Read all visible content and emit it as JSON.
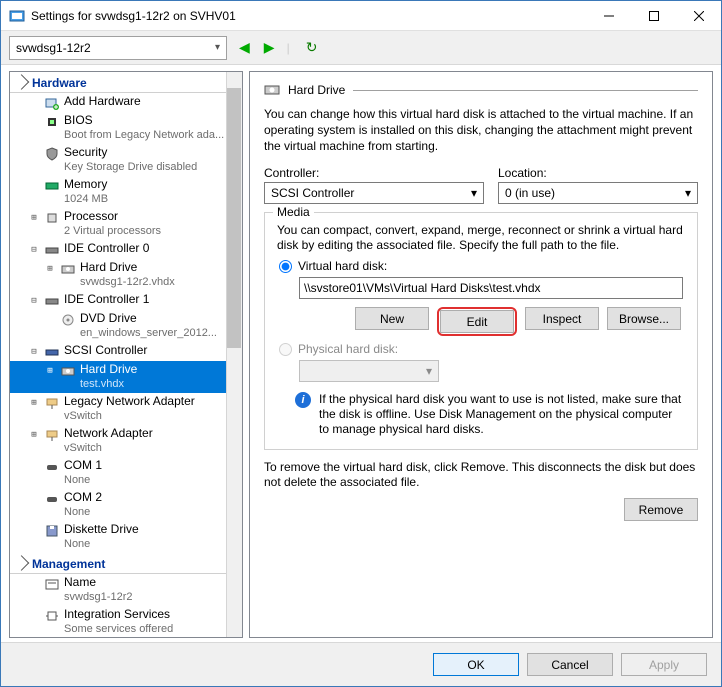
{
  "title": "Settings for svwdsg1-12r2 on SVHV01",
  "toolbar": {
    "vm_selected": "svwdsg1-12r2"
  },
  "sections": {
    "hardware": "Hardware",
    "management": "Management"
  },
  "tree": {
    "add_hardware": "Add Hardware",
    "bios": {
      "label": "BIOS",
      "sub": "Boot from Legacy Network ada..."
    },
    "security": {
      "label": "Security",
      "sub": "Key Storage Drive disabled"
    },
    "memory": {
      "label": "Memory",
      "sub": "1024 MB"
    },
    "processor": {
      "label": "Processor",
      "sub": "2 Virtual processors"
    },
    "ide0": {
      "label": "IDE Controller 0"
    },
    "ide0_hd": {
      "label": "Hard Drive",
      "sub": "svwdsg1-12r2.vhdx"
    },
    "ide1": {
      "label": "IDE Controller 1"
    },
    "ide1_dvd": {
      "label": "DVD Drive",
      "sub": "en_windows_server_2012..."
    },
    "scsi": {
      "label": "SCSI Controller"
    },
    "scsi_hd": {
      "label": "Hard Drive",
      "sub": "test.vhdx"
    },
    "legacy_net": {
      "label": "Legacy Network Adapter",
      "sub": "vSwitch"
    },
    "net": {
      "label": "Network Adapter",
      "sub": "vSwitch"
    },
    "com1": {
      "label": "COM 1",
      "sub": "None"
    },
    "com2": {
      "label": "COM 2",
      "sub": "None"
    },
    "diskette": {
      "label": "Diskette Drive",
      "sub": "None"
    },
    "name": {
      "label": "Name",
      "sub": "svwdsg1-12r2"
    },
    "integration": {
      "label": "Integration Services",
      "sub": "Some services offered"
    }
  },
  "right": {
    "header": "Hard Drive",
    "desc": "You can change how this virtual hard disk is attached to the virtual machine. If an operating system is installed on this disk, changing the attachment might prevent the virtual machine from starting.",
    "controller_label": "Controller:",
    "controller_value": "SCSI Controller",
    "location_label": "Location:",
    "location_value": "0 (in use)",
    "media_legend": "Media",
    "media_desc": "You can compact, convert, expand, merge, reconnect or shrink a virtual hard disk by editing the associated file. Specify the full path to the file.",
    "vhd_radio": "Virtual hard disk:",
    "vhd_path": "\\\\svstore01\\VMs\\Virtual Hard Disks\\test.vhdx",
    "btn_new": "New",
    "btn_edit": "Edit",
    "btn_inspect": "Inspect",
    "btn_browse": "Browse...",
    "phd_radio": "Physical hard disk:",
    "phd_info": "If the physical hard disk you want to use is not listed, make sure that the disk is offline. Use Disk Management on the physical computer to manage physical hard disks.",
    "remove_desc": "To remove the virtual hard disk, click Remove. This disconnects the disk but does not delete the associated file.",
    "btn_remove": "Remove"
  },
  "footer": {
    "ok": "OK",
    "cancel": "Cancel",
    "apply": "Apply"
  }
}
